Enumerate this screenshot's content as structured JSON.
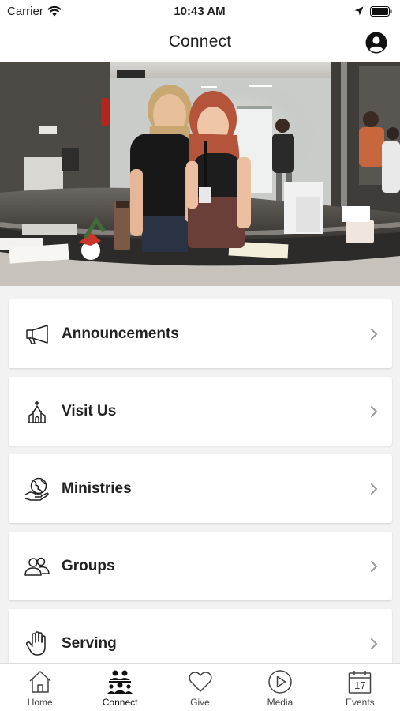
{
  "status_bar": {
    "carrier": "Carrier",
    "time": "10:43 AM"
  },
  "nav": {
    "title": "Connect"
  },
  "menu": {
    "items": [
      {
        "label": "Announcements",
        "icon": "megaphone-icon"
      },
      {
        "label": "Visit Us",
        "icon": "church-icon"
      },
      {
        "label": "Ministries",
        "icon": "globe-hand-icon"
      },
      {
        "label": "Groups",
        "icon": "people-icon"
      },
      {
        "label": "Serving",
        "icon": "hand-icon"
      }
    ]
  },
  "tabs": [
    {
      "label": "Home",
      "icon": "house-icon"
    },
    {
      "label": "Connect",
      "icon": "community-icon",
      "active": true
    },
    {
      "label": "Give",
      "icon": "heart-icon"
    },
    {
      "label": "Media",
      "icon": "play-circle-icon"
    },
    {
      "label": "Events",
      "icon": "calendar-icon"
    }
  ],
  "calendar_day": "17",
  "colors": {
    "accent": "#111111",
    "background": "#f2f2f2",
    "card": "#ffffff"
  }
}
